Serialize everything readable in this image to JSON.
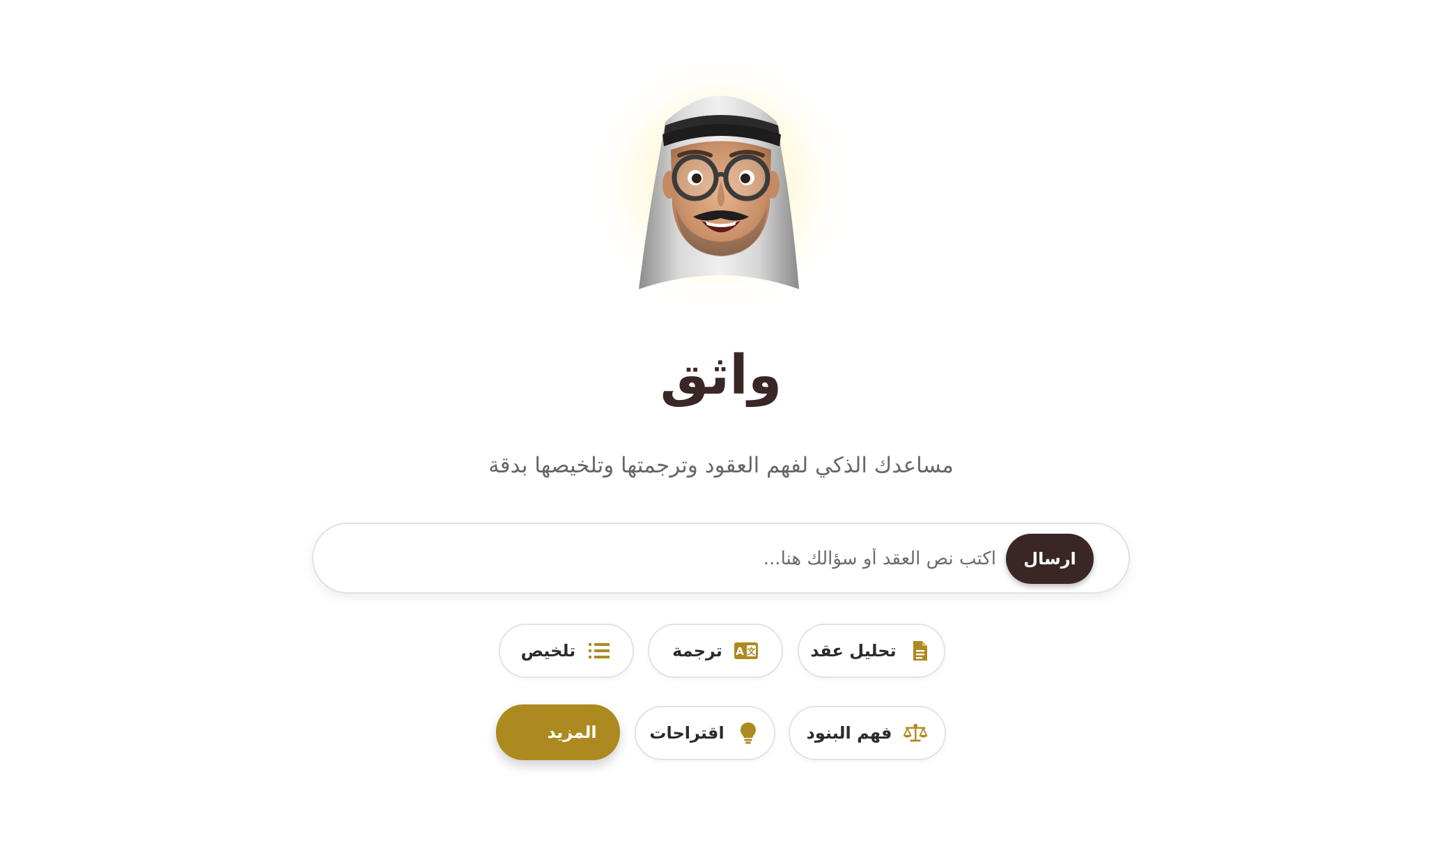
{
  "app": {
    "title": "واثق",
    "subtitle": "مساعدك الذكي لفهم العقود وترجمتها وتلخيصها بدقة"
  },
  "search": {
    "placeholder": "اكتب نص العقد أو سؤالك هنا...",
    "value": "",
    "send_label": "ارسال"
  },
  "actions": {
    "row1": [
      {
        "label": "تحليل عقد",
        "icon": "document-icon"
      },
      {
        "label": "ترجمة",
        "icon": "translate-icon"
      },
      {
        "label": "تلخيص",
        "icon": "list-icon"
      }
    ],
    "row2": [
      {
        "label": "فهم البنود",
        "icon": "scale-icon"
      },
      {
        "label": "اقتراحات",
        "icon": "lightbulb-icon"
      },
      {
        "label": "المزيد",
        "icon": ""
      }
    ]
  },
  "colors": {
    "accent": "#ad8a1f",
    "dark": "#3a2725",
    "text_muted": "#666666",
    "border": "#e2e2e2"
  }
}
